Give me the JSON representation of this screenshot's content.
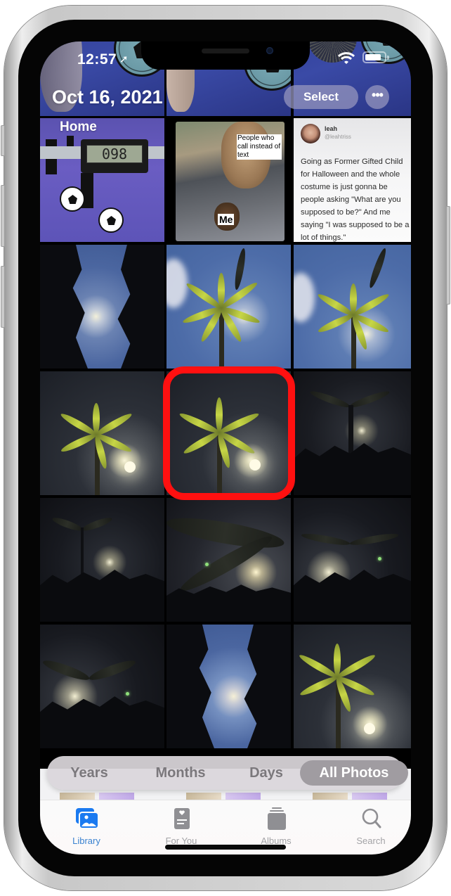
{
  "status_bar": {
    "time": "12:57",
    "location_icon": "location-arrow-icon",
    "wifi_icon": "wifi-icon",
    "battery_icon": "battery-icon"
  },
  "header": {
    "date_title": "Oct 16, 2021",
    "select_label": "Select",
    "more_label": "•••"
  },
  "grid": {
    "row0": [
      {
        "description": "soccer ball earring on blue background"
      },
      {
        "description": "soccer ball earring on blue background"
      },
      {
        "description": "soccer ball earring on blue background"
      }
    ],
    "row1": [
      {
        "location_label": "Home",
        "description": "digital calipers with soccer ball earrings",
        "lcd_value": "098"
      },
      {
        "description": "giraffe meme",
        "caption_top": "People who call instead of text",
        "caption_bottom": "Me"
      },
      {
        "description": "tweet screenshot",
        "tweet_name": "leah",
        "tweet_handle": "@leahtriss",
        "tweet_text": "Going as Former Gifted Child for Halloween and the whole costume is just gonna be people asking \"What are you supposed to be?\" And me saying \"I was supposed to be a lot of things.\""
      }
    ],
    "row2": [
      {
        "description": "moon between trees"
      },
      {
        "description": "palm tree under blue sky"
      },
      {
        "description": "palm tree under blue sky"
      }
    ],
    "row3": [
      {
        "description": "palm tree at night"
      },
      {
        "description": "palm tree at night",
        "selected": true
      },
      {
        "description": "palm silhouettes with moon"
      }
    ],
    "row4": [
      {
        "description": "palm silhouettes with moon"
      },
      {
        "description": "palm fronds with moon"
      },
      {
        "description": "palm silhouettes with moon"
      }
    ],
    "row5": [
      {
        "description": "palm silhouettes with moon"
      },
      {
        "description": "moon between trees"
      },
      {
        "description": "palm tree at night"
      }
    ]
  },
  "view_switcher": {
    "options": [
      "Years",
      "Months",
      "Days",
      "All Photos"
    ],
    "selected": "All Photos"
  },
  "tab_bar": {
    "tabs": [
      {
        "label": "Library",
        "icon": "photo-library-icon",
        "active": true
      },
      {
        "label": "For You",
        "icon": "for-you-icon",
        "active": false
      },
      {
        "label": "Albums",
        "icon": "albums-icon",
        "active": false
      },
      {
        "label": "Search",
        "icon": "search-icon",
        "active": false
      }
    ]
  },
  "colors": {
    "accent": "#3a82d0",
    "highlight_ring": "#ff1010",
    "inactive_tab": "#a3a3a6"
  }
}
